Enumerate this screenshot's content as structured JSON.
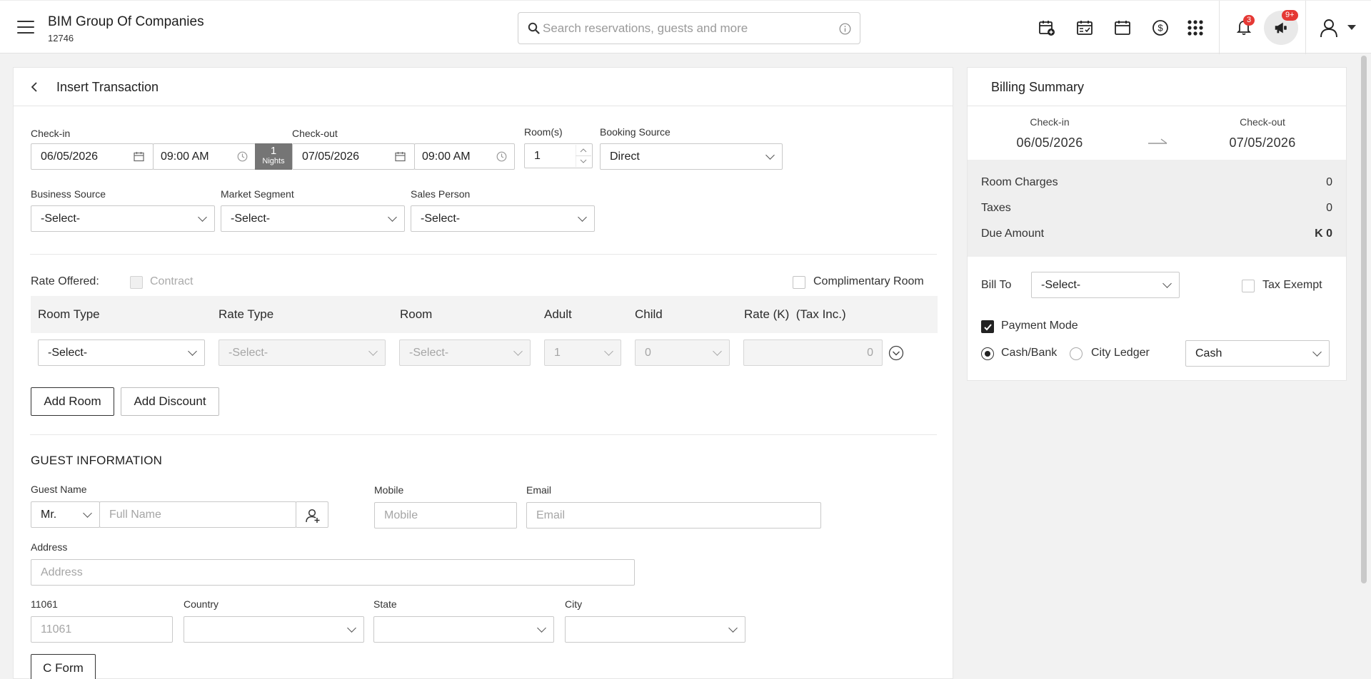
{
  "app": {
    "company": "BIM Group Of Companies",
    "code": "12746"
  },
  "search": {
    "placeholder": "Search reservations, guests and more"
  },
  "header_icons": [
    "calendar-add-icon",
    "calendar-check-icon",
    "calendar-icon",
    "dollar-icon",
    "apps-grid-icon",
    "bell-icon",
    "megaphone-icon",
    "user-icon"
  ],
  "notifications": {
    "bell_count": "3",
    "announce_count": "9+"
  },
  "page": {
    "title": "Insert Transaction"
  },
  "stay": {
    "checkin_label": "Check-in",
    "checkin_date": "06/05/2026",
    "checkin_time": "09:00 AM",
    "nights": "1",
    "nights_label": "Nights",
    "checkout_label": "Check-out",
    "checkout_date": "07/05/2026",
    "checkout_time": "09:00 AM",
    "rooms_label": "Room(s)",
    "rooms_value": "1",
    "booking_source_label": "Booking Source",
    "booking_source_value": "Direct"
  },
  "segments": {
    "business_source_label": "Business Source",
    "business_source_value": "-Select-",
    "market_segment_label": "Market Segment",
    "market_segment_value": "-Select-",
    "sales_person_label": "Sales Person",
    "sales_person_value": "-Select-"
  },
  "rate": {
    "offered_label": "Rate Offered:",
    "contract_label": "Contract",
    "complimentary_label": "Complimentary Room",
    "columns": [
      "Room Type",
      "Rate Type",
      "Room",
      "Adult",
      "Child",
      "Rate (K)  (Tax Inc.)"
    ],
    "row": {
      "room_type": "-Select-",
      "rate_type": "-Select-",
      "room": "-Select-",
      "adult": "1",
      "child": "0",
      "rate": "0"
    }
  },
  "actions": {
    "add_room": "Add Room",
    "add_discount": "Add Discount"
  },
  "guest": {
    "section_title": "GUEST INFORMATION",
    "name_label": "Guest Name",
    "salutation": "Mr.",
    "name_placeholder": "Full Name",
    "mobile_label": "Mobile",
    "mobile_placeholder": "Mobile",
    "email_label": "Email",
    "email_placeholder": "Email",
    "address_label": "Address",
    "address_placeholder": "Address",
    "zip_label": "11061",
    "zip_placeholder": "11061",
    "country_label": "Country",
    "state_label": "State",
    "city_label": "City",
    "cform_label": "C Form"
  },
  "billing": {
    "title": "Billing Summary",
    "checkin_label": "Check-in",
    "checkin_value": "06/05/2026",
    "checkout_label": "Check-out",
    "checkout_value": "07/05/2026",
    "room_charges_label": "Room Charges",
    "room_charges_value": "0",
    "taxes_label": "Taxes",
    "taxes_value": "0",
    "due_label": "Due Amount",
    "due_value": "K 0",
    "bill_to_label": "Bill To",
    "bill_to_value": "-Select-",
    "tax_exempt_label": "Tax Exempt",
    "payment_mode_label": "Payment Mode",
    "cash_bank_label": "Cash/Bank",
    "city_ledger_label": "City Ledger",
    "payment_type_value": "Cash"
  }
}
